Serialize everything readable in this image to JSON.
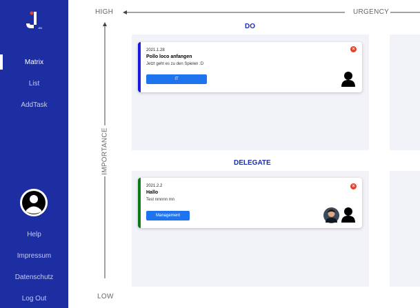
{
  "sidebar": {
    "nav": [
      {
        "label": "Matrix",
        "active": true
      },
      {
        "label": "List",
        "active": false
      },
      {
        "label": "AddTask",
        "active": false
      }
    ],
    "bottom": [
      {
        "label": "Help"
      },
      {
        "label": "Impressum"
      },
      {
        "label": "Datenschutz"
      },
      {
        "label": "Log Out"
      }
    ],
    "avatar_icon": "user-avatar-icon"
  },
  "axes": {
    "urgency_high": "HIGH",
    "urgency": "URGENCY",
    "importance": "IMPORTANCE",
    "importance_low": "LOW"
  },
  "quadrants": {
    "do": {
      "title": "DO",
      "card": {
        "date": "2021.1.28",
        "title": "Pollo loco anfangen",
        "description": "Jetzt geht es zu den Spielen :D",
        "category": "IT",
        "color": "#1a1ae0"
      }
    },
    "delegate": {
      "title": "DELEGATE",
      "card": {
        "date": "2021.2.2",
        "title": "Hallo",
        "description": "Test nmnnn mn",
        "category": "Management",
        "color": "#0e7a17"
      }
    }
  },
  "colors": {
    "sidebar": "#1d2ea3",
    "button": "#1e74ee",
    "close": "#e1452a"
  }
}
